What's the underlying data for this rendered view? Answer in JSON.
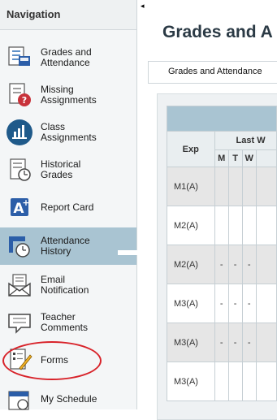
{
  "sidebar": {
    "heading": "Navigation",
    "items": [
      {
        "label": "Grades and\nAttendance",
        "icon": "grades-attendance-icon"
      },
      {
        "label": "Missing\nAssignments",
        "icon": "missing-assignments-icon"
      },
      {
        "label": "Class\nAssignments",
        "icon": "class-assignments-icon"
      },
      {
        "label": "Historical\nGrades",
        "icon": "historical-grades-icon"
      },
      {
        "label": "Report Card",
        "icon": "report-card-icon"
      },
      {
        "label": "Attendance\nHistory",
        "icon": "attendance-history-icon"
      },
      {
        "label": "Email\nNotification",
        "icon": "email-notification-icon"
      },
      {
        "label": "Teacher\nComments",
        "icon": "teacher-comments-icon"
      },
      {
        "label": "Forms",
        "icon": "forms-icon"
      },
      {
        "label": "My Schedule",
        "icon": "my-schedule-icon"
      }
    ],
    "active_item": "Attendance\nHistory",
    "highlighted_item": "Forms",
    "colors": {
      "active_bg": "#a9c4d2",
      "highlight_circle": "#d8232a"
    }
  },
  "main": {
    "title": "Grades and A",
    "breadcrumb": "Grades and Attendance"
  },
  "table": {
    "exp_header": "Exp",
    "group_header": "Last W",
    "day_headers": [
      "M",
      "T",
      "W"
    ],
    "rows": [
      {
        "exp": "M1(A)",
        "cells": [
          "",
          "",
          ""
        ]
      },
      {
        "exp": "M2(A)",
        "cells": [
          "",
          "",
          ""
        ]
      },
      {
        "exp": "M2(A)",
        "cells": [
          "-",
          "-",
          "-"
        ]
      },
      {
        "exp": "M3(A)",
        "cells": [
          "-",
          "-",
          "-"
        ]
      },
      {
        "exp": "M3(A)",
        "cells": [
          "-",
          "-",
          "-"
        ]
      },
      {
        "exp": "M3(A)",
        "cells": [
          "",
          "",
          ""
        ]
      }
    ]
  }
}
